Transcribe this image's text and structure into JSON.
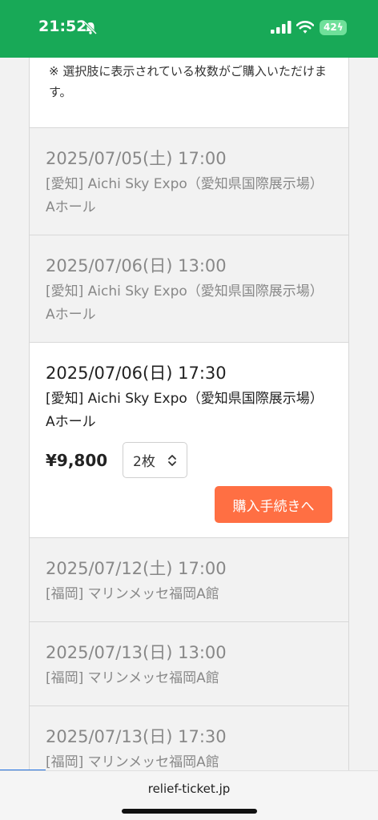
{
  "status": {
    "time": "21:52",
    "battery": "42"
  },
  "note": {
    "text": "※ 選択肢に表示されている枚数がご購入いただけます。"
  },
  "performances": [
    {
      "date": "2025/07/05(土) 17:00",
      "venue": "[愛知] Aichi Sky Expo（愛知県国際展示場）Aホール"
    },
    {
      "date": "2025/07/06(日) 13:00",
      "venue": "[愛知] Aichi Sky Expo（愛知県国際展示場）Aホール"
    },
    {
      "date": "2025/07/06(日) 17:30",
      "venue": "[愛知] Aichi Sky Expo（愛知県国際展示場）Aホール",
      "price": "¥9,800",
      "quantity": "2枚",
      "buy_label": "購入手続きへ"
    },
    {
      "date": "2025/07/12(土) 17:00",
      "venue": "[福岡] マリンメッセ福岡A館"
    },
    {
      "date": "2025/07/13(日) 13:00",
      "venue": "[福岡] マリンメッセ福岡A館"
    },
    {
      "date": "2025/07/13(日) 17:30",
      "venue": "[福岡] マリンメッセ福岡A館"
    }
  ],
  "browser": {
    "url": "relief-ticket.jp"
  },
  "colors": {
    "status_bar": "#18a957",
    "buy_button": "#ff6f43",
    "progress": "#1f6fe0"
  },
  "icons": {
    "bell": "bell-slash-icon",
    "signal": "cellular-signal-icon",
    "wifi": "wifi-icon",
    "chevron": "chevron-up-down-icon"
  }
}
